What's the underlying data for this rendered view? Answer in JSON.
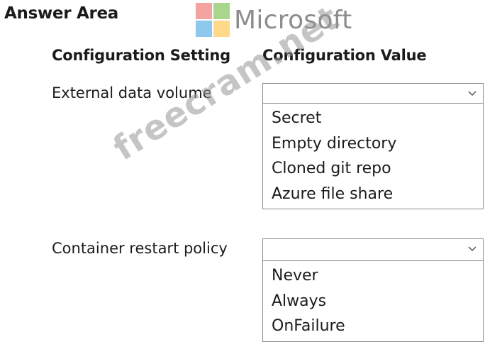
{
  "header": {
    "title": "Answer Area",
    "logo_text": "Microsoft",
    "logo_colors": [
      "#f25022",
      "#7fba00",
      "#00a4ef",
      "#ffb900"
    ]
  },
  "columns": {
    "setting": "Configuration Setting",
    "value": "Configuration Value"
  },
  "rows": [
    {
      "label": "External data volume",
      "selected": "",
      "options": [
        "Secret",
        "Empty directory",
        "Cloned git repo",
        "Azure file share"
      ]
    },
    {
      "label": "Container restart policy",
      "selected": "",
      "options": [
        "Never",
        "Always",
        "OnFailure"
      ]
    }
  ],
  "watermark": "freecram.net"
}
